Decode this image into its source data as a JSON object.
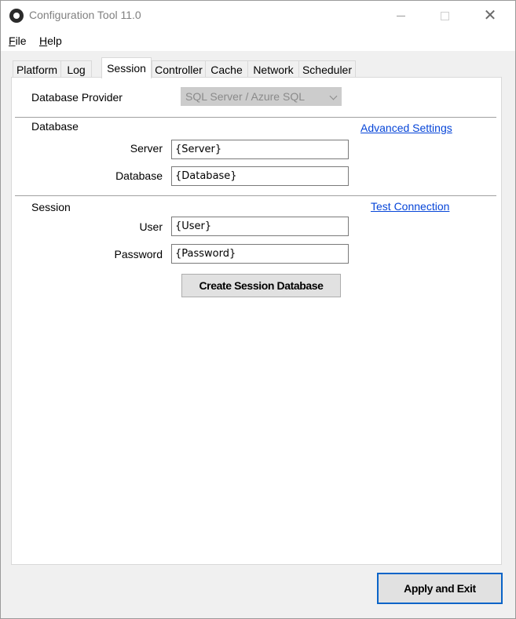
{
  "window": {
    "title": "Configuration Tool 11.0"
  },
  "menu": {
    "file": {
      "accel": "F",
      "rest": "ile"
    },
    "help": {
      "accel": "H",
      "rest": "elp"
    }
  },
  "tabs": [
    {
      "label": "Platform",
      "active": false
    },
    {
      "label": "Log",
      "active": false
    },
    {
      "label": "Session",
      "active": true
    },
    {
      "label": "Controller",
      "active": false
    },
    {
      "label": "Cache",
      "active": false
    },
    {
      "label": "Network",
      "active": false
    },
    {
      "label": "Scheduler",
      "active": false
    }
  ],
  "session_tab": {
    "provider_label": "Database Provider",
    "provider_value": "SQL Server / Azure SQL",
    "database_section": {
      "heading": "Database",
      "advanced_link": "Advanced Settings",
      "server_label": "Server",
      "server_value": "{Server}",
      "database_label": "Database",
      "database_value": "{Database}"
    },
    "session_section": {
      "heading": "Session",
      "test_link": "Test Connection",
      "user_label": "User",
      "user_value": "{User}",
      "password_label": "Password",
      "password_value": "{Password}"
    },
    "create_button": "Create Session Database"
  },
  "footer": {
    "apply_button": "Apply and Exit"
  },
  "colors": {
    "link": "#0645d8",
    "focus_border": "#0a64c8",
    "disabled_combo": "#cccccc"
  }
}
